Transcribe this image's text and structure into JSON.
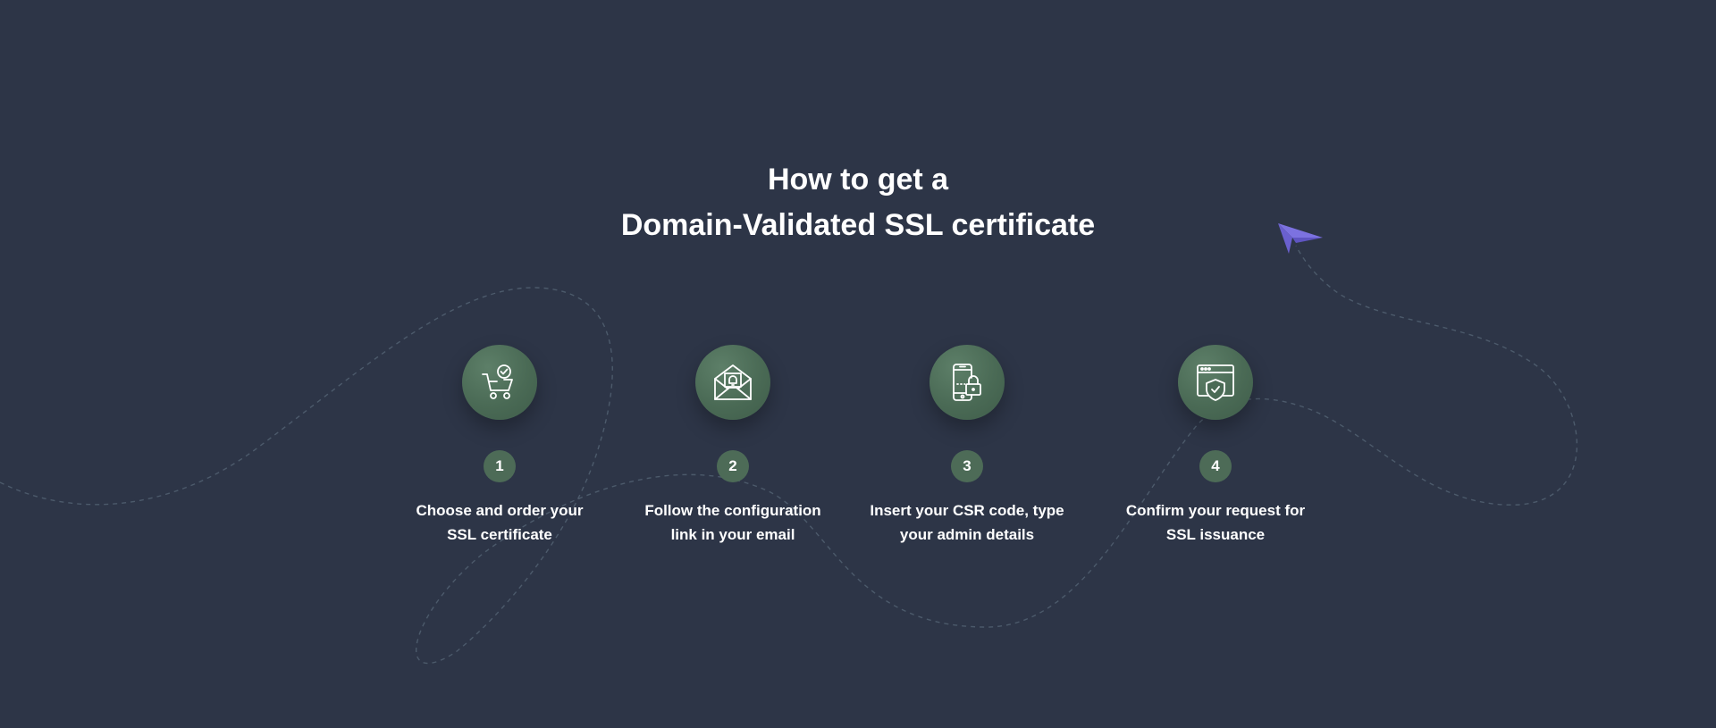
{
  "title": {
    "line1": "How to get a",
    "line2": "Domain-Validated SSL certificate"
  },
  "colors": {
    "background": "#2d3547",
    "icon_circle": "#4a6a55",
    "number_circle": "#4d6b57",
    "paper_plane": "#7c72e0",
    "dashed_path": "#4c5a6b"
  },
  "steps": [
    {
      "number": "1",
      "icon": "shopping-cart-check-icon",
      "text": "Choose and order your SSL certificate"
    },
    {
      "number": "2",
      "icon": "envelope-bell-icon",
      "text": "Follow the configuration link in your email"
    },
    {
      "number": "3",
      "icon": "phone-lock-icon",
      "text": "Insert your CSR code, type your admin details"
    },
    {
      "number": "4",
      "icon": "browser-shield-icon",
      "text": "Confirm your request for SSL issuance"
    }
  ]
}
